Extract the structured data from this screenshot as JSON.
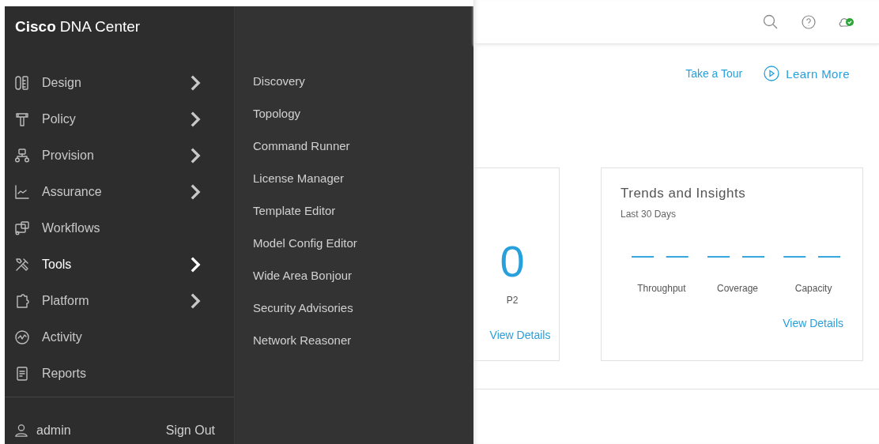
{
  "brand": {
    "bold": "Cisco",
    "rest": "DNA Center"
  },
  "nav": {
    "items": [
      {
        "label": "Design",
        "kind": "design",
        "has_submenu": true,
        "selected": false
      },
      {
        "label": "Policy",
        "kind": "policy",
        "has_submenu": true,
        "selected": false
      },
      {
        "label": "Provision",
        "kind": "provision",
        "has_submenu": true,
        "selected": false
      },
      {
        "label": "Assurance",
        "kind": "assurance",
        "has_submenu": true,
        "selected": false
      },
      {
        "label": "Workflows",
        "kind": "workflows",
        "has_submenu": false,
        "selected": false
      },
      {
        "label": "Tools",
        "kind": "tools",
        "has_submenu": true,
        "selected": true
      },
      {
        "label": "Platform",
        "kind": "platform",
        "has_submenu": true,
        "selected": false
      },
      {
        "label": "Activity",
        "kind": "activity",
        "has_submenu": false,
        "selected": false
      },
      {
        "label": "Reports",
        "kind": "reports",
        "has_submenu": false,
        "selected": false
      }
    ]
  },
  "user": {
    "name": "admin",
    "sign_out": "Sign Out"
  },
  "submenu": {
    "items": [
      "Discovery",
      "Topology",
      "Command Runner",
      "License Manager",
      "Template Editor",
      "Model Config Editor",
      "Wide Area Bonjour",
      "Security Advisories",
      "Network Reasoner"
    ]
  },
  "tour": {
    "take_tour": "Take a Tour",
    "learn_more": "Learn More"
  },
  "cards": [
    {
      "kind": "count",
      "value": "0",
      "label": "P2",
      "link": "View Details"
    },
    {
      "kind": "trends",
      "title": "Trends and Insights",
      "subtitle": "Last 30 Days",
      "metrics": [
        {
          "value": "— —",
          "label": "Throughput"
        },
        {
          "value": "— —",
          "label": "Coverage"
        },
        {
          "value": "— —",
          "label": "Capacity"
        }
      ],
      "link": "View Details"
    }
  ]
}
